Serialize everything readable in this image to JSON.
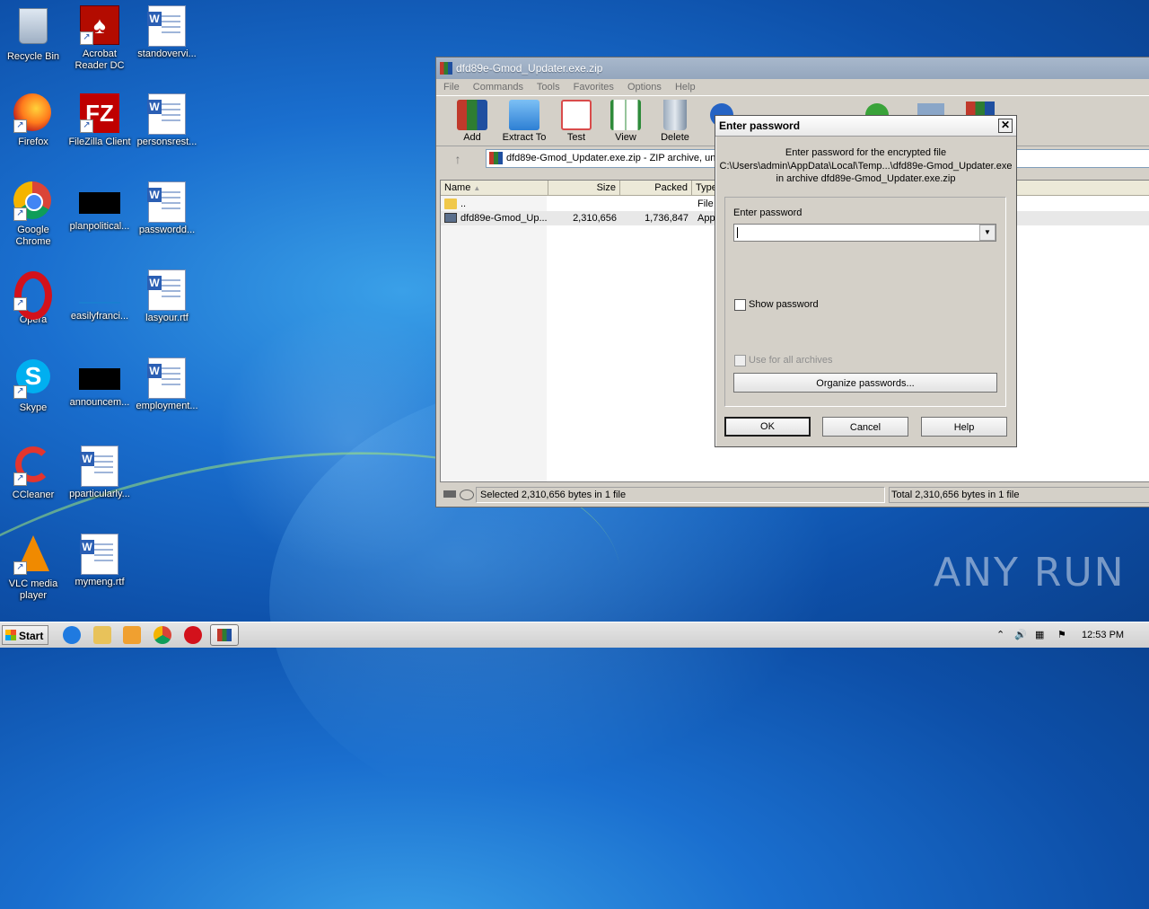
{
  "desktop": {
    "icons": [
      {
        "label": "Recycle Bin",
        "icon": "recycle-bin-icon"
      },
      {
        "label": "Acrobat Reader DC",
        "label2": "Reader DC",
        "label1": "Acrobat",
        "icon": "acrobat-icon"
      },
      {
        "label": "standovervi...",
        "icon": "word-doc-icon"
      },
      {
        "label": "Firefox",
        "icon": "firefox-icon"
      },
      {
        "label": "FileZilla Client",
        "icon": "filezilla-icon"
      },
      {
        "label": "personsrest...",
        "icon": "word-doc-icon"
      },
      {
        "label1": "Google",
        "label2": "Chrome",
        "icon": "chrome-icon"
      },
      {
        "label": "planpolitical...",
        "icon": "black-file-icon"
      },
      {
        "label": "passwordd...",
        "icon": "word-doc-icon"
      },
      {
        "label": "Opera",
        "icon": "opera-icon"
      },
      {
        "label": "easilyfranci...",
        "icon": "blank-file-icon"
      },
      {
        "label": "lasyour.rtf",
        "icon": "word-doc-icon"
      },
      {
        "label": "Skype",
        "icon": "skype-icon"
      },
      {
        "label": "announcem...",
        "icon": "black-file-icon"
      },
      {
        "label": "employment...",
        "icon": "word-doc-icon"
      },
      {
        "label": "CCleaner",
        "icon": "ccleaner-icon"
      },
      {
        "label": "pparticularly...",
        "icon": "word-doc-icon"
      },
      {
        "label1": "VLC media",
        "label2": "player",
        "icon": "vlc-icon"
      },
      {
        "label": "mymeng.rtf",
        "icon": "word-doc-icon"
      }
    ]
  },
  "winrar": {
    "title": "dfd89e-Gmod_Updater.exe.zip",
    "menu": [
      "File",
      "Commands",
      "Tools",
      "Favorites",
      "Options",
      "Help"
    ],
    "toolbar": [
      {
        "label": "Add",
        "color": "#c0392b"
      },
      {
        "label": "Extract To",
        "color": "#2d7fd4"
      },
      {
        "label": "Test",
        "color": "#d94b4b"
      },
      {
        "label": "View",
        "color": "#2e8b3a"
      },
      {
        "label": "Delete",
        "color": "#7d8fa3"
      }
    ],
    "address": "dfd89e-Gmod_Updater.exe.zip - ZIP archive, un",
    "columns": [
      "Name",
      "Size",
      "Packed",
      "Type"
    ],
    "rows": [
      {
        "name": "..",
        "size": "",
        "packed": "",
        "type": "File"
      },
      {
        "name": "dfd89e-Gmod_Up...",
        "size": "2,310,656",
        "packed": "1,736,847",
        "type": "Appl"
      }
    ],
    "status_left": "Selected 2,310,656 bytes in 1 file",
    "status_right": "Total 2,310,656 bytes in 1 file"
  },
  "dialog": {
    "title": "Enter password",
    "line1": "Enter password for the encrypted file",
    "line2": "C:\\Users\\admin\\AppData\\Local\\Temp...\\dfd89e-Gmod_Updater.exe",
    "line3": "in archive dfd89e-Gmod_Updater.exe.zip",
    "field_label": "Enter password",
    "password_value": "",
    "show_password": "Show password",
    "use_for_all": "Use for all archives",
    "organize": "Organize passwords...",
    "ok": "OK",
    "cancel": "Cancel",
    "help": "Help"
  },
  "taskbar": {
    "start": "Start",
    "clock": "12:53 PM"
  },
  "watermark": "ANY RUN"
}
